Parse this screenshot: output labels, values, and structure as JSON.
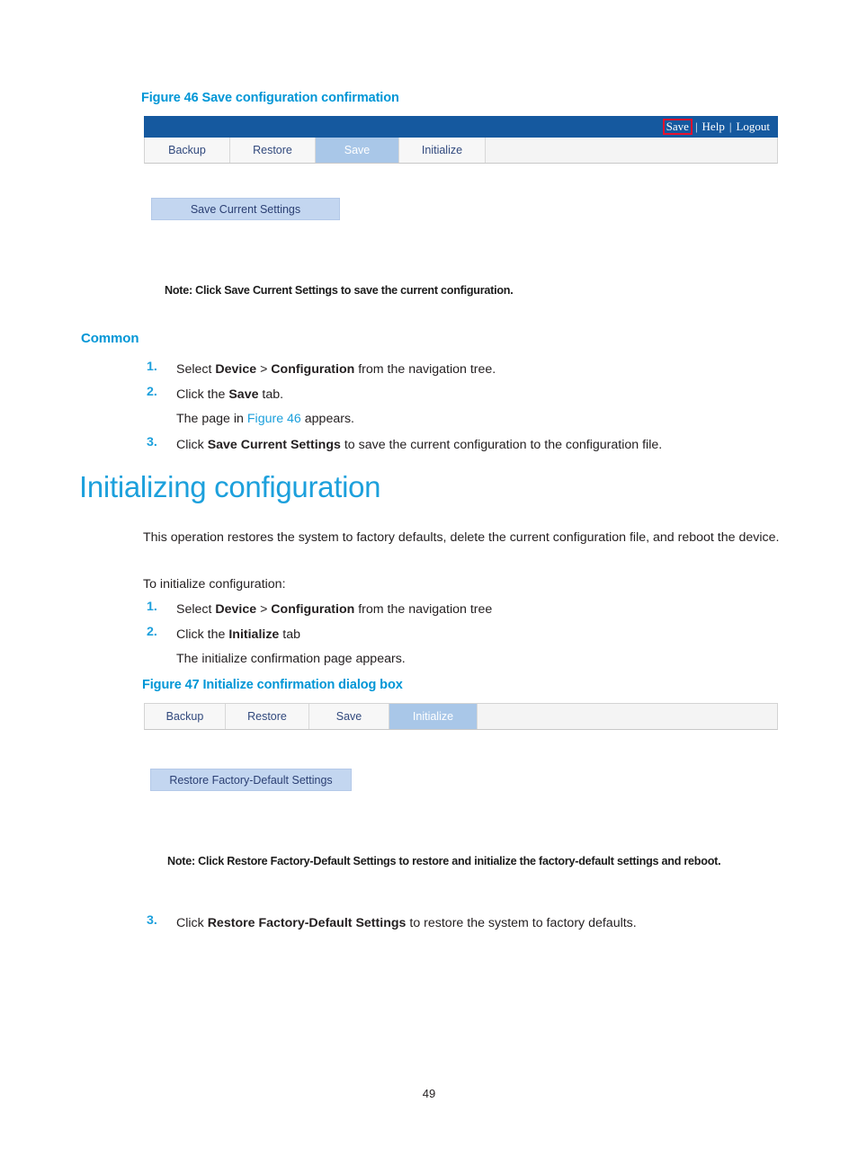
{
  "page": {
    "number": "49"
  },
  "figure46": {
    "caption": "Figure 46 Save configuration confirmation",
    "titlebar": {
      "save_link": "Save",
      "help_link": "Help",
      "logout_link": "Logout",
      "separator": "|",
      "highlight_color": "#e8112d",
      "background_color": "#15599f"
    },
    "tabs": [
      {
        "label": "Backup",
        "active": false
      },
      {
        "label": "Restore",
        "active": false
      },
      {
        "label": "Save",
        "active": true
      },
      {
        "label": "Initialize",
        "active": false
      }
    ],
    "button": {
      "label": "Save Current Settings"
    },
    "note": "Note: Click Save Current Settings to save the current configuration."
  },
  "common_section": {
    "heading": "Common",
    "steps": [
      {
        "number": "1.",
        "segments": [
          {
            "text": "Select ",
            "style": "normal"
          },
          {
            "text": "Device",
            "style": "bold"
          },
          {
            "text": " > ",
            "style": "normal"
          },
          {
            "text": "Configuration",
            "style": "bold"
          },
          {
            "text": " from the navigation tree.",
            "style": "normal"
          }
        ]
      },
      {
        "number": "2.",
        "segments": [
          {
            "text": "Click the ",
            "style": "normal"
          },
          {
            "text": "Save",
            "style": "bold"
          },
          {
            "text": " tab.",
            "style": "normal"
          }
        ]
      },
      {
        "number": "3.",
        "segments": [
          {
            "text": "Click ",
            "style": "normal"
          },
          {
            "text": "Save Current Settings",
            "style": "bold"
          },
          {
            "text": " to save the current configuration to the configuration file.",
            "style": "normal"
          }
        ]
      }
    ],
    "substep": {
      "prefix": "The page in ",
      "xref": "Figure 46",
      "suffix": " appears."
    }
  },
  "initializing_section": {
    "heading": "Initializing configuration",
    "intro": "This operation restores the system to factory defaults, delete the current configuration file, and reboot the device.",
    "lead_in": "To initialize configuration:",
    "steps": [
      {
        "number": "1.",
        "segments": [
          {
            "text": "Select ",
            "style": "normal"
          },
          {
            "text": "Device",
            "style": "bold"
          },
          {
            "text": " > ",
            "style": "normal"
          },
          {
            "text": "Configuration",
            "style": "bold"
          },
          {
            "text": " from the navigation tree",
            "style": "normal"
          }
        ]
      },
      {
        "number": "2.",
        "segments": [
          {
            "text": "Click the ",
            "style": "normal"
          },
          {
            "text": "Initialize",
            "style": "bold"
          },
          {
            "text": " tab",
            "style": "normal"
          }
        ]
      },
      {
        "number": "3.",
        "segments": [
          {
            "text": "Click ",
            "style": "normal"
          },
          {
            "text": "Restore Factory-Default Settings",
            "style": "bold"
          },
          {
            "text": " to restore the system to factory defaults.",
            "style": "normal"
          }
        ]
      }
    ],
    "substep": "The initialize confirmation page appears."
  },
  "figure47": {
    "caption": "Figure 47 Initialize confirmation dialog box",
    "tabs": [
      {
        "label": "Backup",
        "active": false
      },
      {
        "label": "Restore",
        "active": false
      },
      {
        "label": "Save",
        "active": false
      },
      {
        "label": "Initialize",
        "active": true
      }
    ],
    "button": {
      "label": "Restore Factory-Default Settings"
    },
    "note": "Note: Click Restore Factory-Default Settings to restore and initialize the factory-default settings and reboot."
  }
}
